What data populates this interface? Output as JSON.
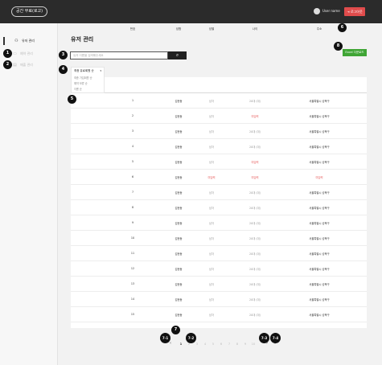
{
  "header": {
    "logo": "공간 무료(로고)",
    "user_name": "User name",
    "logout_label": "로그아웃"
  },
  "sidebar": {
    "items": [
      {
        "label": "유저 관리",
        "icon": "users-icon",
        "state": "active"
      },
      {
        "label": "예약 관리",
        "icon": "calendar-icon",
        "state": "disabled"
      },
      {
        "label": "매출 관리",
        "icon": "chart-icon",
        "state": "disabled"
      }
    ]
  },
  "main": {
    "title": "유저 관리",
    "search_placeholder": "유저 이름을 검색해주세요",
    "search_icon": "search-icon",
    "excel_button": "Excel 다운로드",
    "sort": {
      "selected": "최종 유료회원 순",
      "options": [
        "최종 가입회원 순",
        "예약 보류 순",
        "이름 순"
      ]
    },
    "columns": [
      "번호",
      "성함",
      "성별",
      "나이",
      "주소"
    ]
  },
  "table": {
    "rows": [
      {
        "no": "1",
        "name": "김현동",
        "gender": "남자",
        "age": "20대 (대)",
        "addr": "서울특별시 성북구"
      },
      {
        "no": "2",
        "name": "김현동",
        "gender": "남자",
        "age": "미입력",
        "addr": "서울특별시 성북구"
      },
      {
        "no": "3",
        "name": "김현동",
        "gender": "남자",
        "age": "20대 (대)",
        "addr": "서울특별시 성북구"
      },
      {
        "no": "4",
        "name": "김현동",
        "gender": "남자",
        "age": "20대 (대)",
        "addr": "서울특별시 성북구"
      },
      {
        "no": "5",
        "name": "김현동",
        "gender": "남자",
        "age": "미입력",
        "addr": "서울특별시 성북구"
      },
      {
        "no": "6",
        "name": "김현동",
        "gender": "미입력",
        "age": "미입력",
        "addr": "미입력"
      },
      {
        "no": "7",
        "name": "김현동",
        "gender": "남자",
        "age": "20대 (대)",
        "addr": "서울특별시 성북구"
      },
      {
        "no": "8",
        "name": "김현동",
        "gender": "남자",
        "age": "20대 (대)",
        "addr": "서울특별시 성북구"
      },
      {
        "no": "9",
        "name": "김현동",
        "gender": "남자",
        "age": "20대 (대)",
        "addr": "서울특별시 성북구"
      },
      {
        "no": "10",
        "name": "김현동",
        "gender": "남자",
        "age": "20대 (대)",
        "addr": "서울특별시 성북구"
      },
      {
        "no": "11",
        "name": "김현동",
        "gender": "남자",
        "age": "20대 (대)",
        "addr": "서울특별시 성북구"
      },
      {
        "no": "12",
        "name": "김현동",
        "gender": "남자",
        "age": "20대 (대)",
        "addr": "서울특별시 성북구"
      },
      {
        "no": "13",
        "name": "김현동",
        "gender": "남자",
        "age": "20대 (대)",
        "addr": "서울특별시 성북구"
      },
      {
        "no": "14",
        "name": "김현동",
        "gender": "남자",
        "age": "20대 (대)",
        "addr": "서울특별시 성북구"
      },
      {
        "no": "15",
        "name": "김현동",
        "gender": "남자",
        "age": "20대 (대)",
        "addr": "서울특별시 성북구"
      }
    ],
    "missing_value": "미입력"
  },
  "pagination": {
    "prev": "‹",
    "next": "›",
    "last": "»",
    "pages": [
      "1",
      "2",
      "3",
      "4",
      "5",
      "6",
      "7",
      "8",
      "9",
      "10"
    ],
    "current": "1"
  },
  "annotations": [
    "1",
    "2",
    "3",
    "4",
    "5",
    "6",
    "7",
    "8",
    "7-1",
    "7-2",
    "7-3",
    "7-4"
  ],
  "colors": {
    "header_bg": "#2b2b2b",
    "logout_bg": "#e04c4c",
    "excel_bg": "#3fa535",
    "missing_text": "#e65454",
    "muted_text": "#999999"
  }
}
